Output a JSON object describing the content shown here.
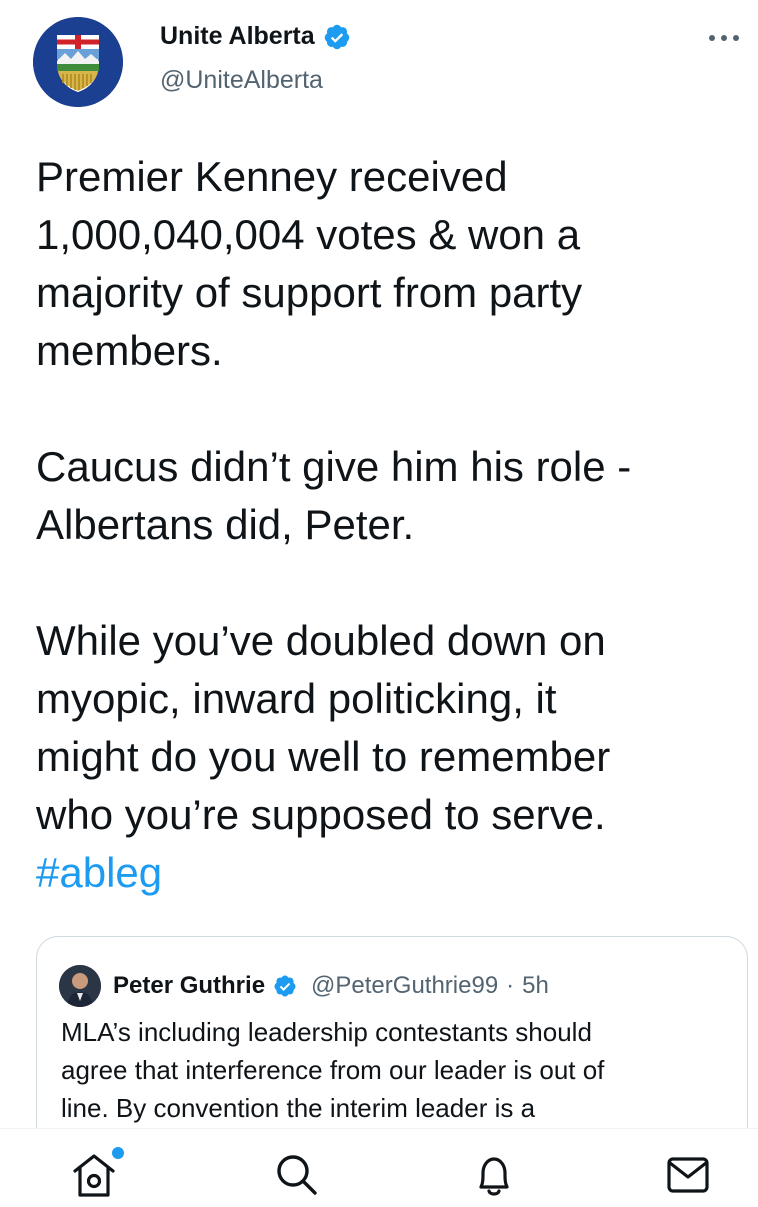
{
  "account": {
    "display_name": "Unite Alberta",
    "handle": "@UniteAlberta",
    "verified": true
  },
  "tweet": {
    "paragraphs": [
      [
        "Premier Kenney received",
        "1,000,040,004 votes & won a",
        "majority of support from party",
        "members."
      ],
      [
        "Caucus didn’t give him his role -",
        "Albertans did, Peter."
      ],
      [
        "While you’ve doubled down on",
        "myopic, inward politicking, it",
        "might do you well to remember",
        "who you’re supposed to serve."
      ]
    ],
    "hashtag": "#ableg"
  },
  "quoted_tweet": {
    "display_name": "Peter Guthrie",
    "handle": "@PeterGuthrie99",
    "separator": "·",
    "time": "5h",
    "lines": [
      "MLA’s including leadership contestants should",
      "agree that interference from our leader is out of",
      "line. By convention the interim leader is a"
    ]
  },
  "icons": {
    "more": "more-horizontal-icon",
    "verified": "verified-badge-icon",
    "tabs": [
      "home-icon",
      "search-icon",
      "notifications-bell-icon",
      "messages-envelope-icon"
    ]
  },
  "colors": {
    "accent": "#1d9bf0",
    "text": "#0f1419",
    "secondary_text": "#536471",
    "border": "#cfd9de"
  }
}
